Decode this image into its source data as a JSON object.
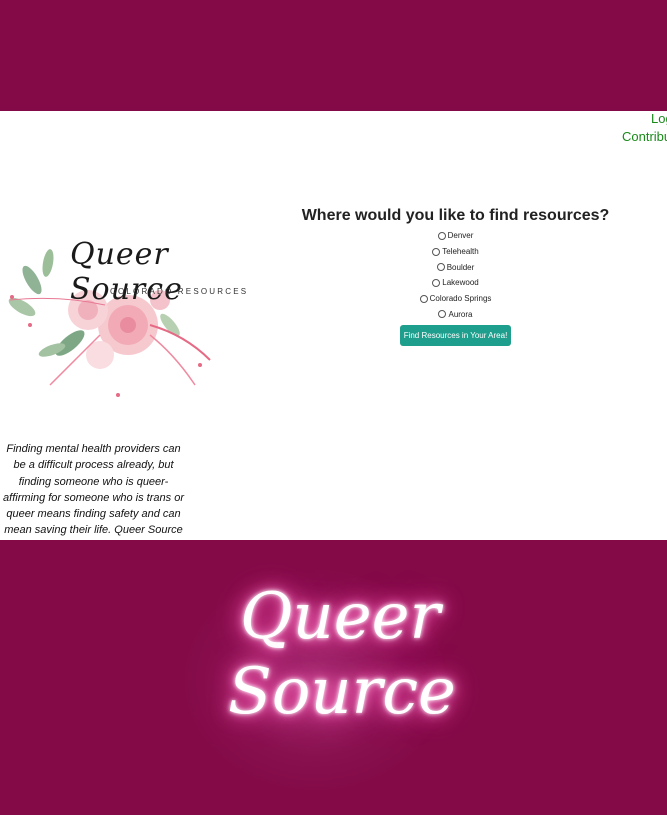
{
  "header": {
    "nav": {
      "login": "Log",
      "contribute": "Contribu"
    }
  },
  "logo": {
    "script_text": "Queer Source",
    "subtitle": "COLORADO RESOURCES"
  },
  "intro_text": "Finding mental health providers can be a difficult process already, but finding someone who is queer-affirming for someone who is trans or queer means finding safety and can mean saving their life. Queer Source is here to help you.",
  "finder": {
    "title": "Where would you like to find resources?",
    "options": [
      "Denver",
      "Telehealth",
      "Boulder",
      "Lakewood",
      "Colorado Springs",
      "Aurora"
    ],
    "button_label": "Find Resources in Your Area!"
  },
  "footer": {
    "neon_line1": "Queer",
    "neon_line2": "Source"
  },
  "colors": {
    "brand": "#830a47",
    "link": "#1a8a1a",
    "button": "#1e9e8c"
  }
}
